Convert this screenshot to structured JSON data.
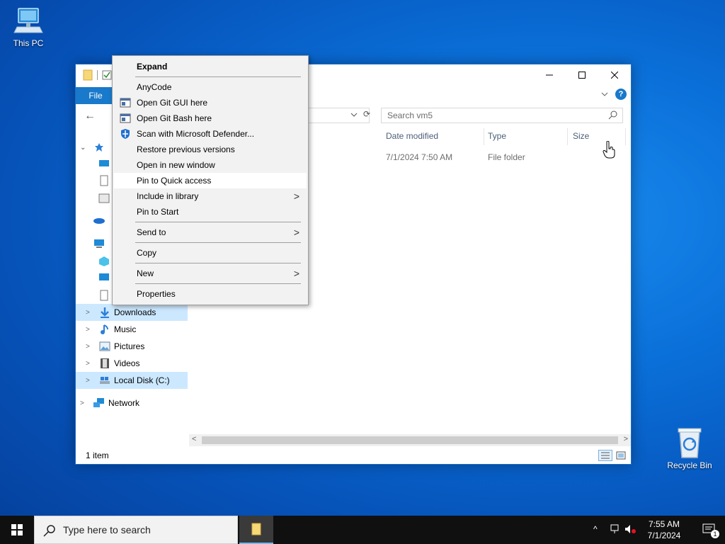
{
  "desktop": {
    "this_pc_label": "This PC",
    "recycle_bin_label": "Recycle Bin"
  },
  "explorer": {
    "ribbon": {
      "file_tab": "File"
    },
    "search_placeholder": "Search vm5",
    "nav_items": [
      {
        "label": "Downloads",
        "selected": true
      },
      {
        "label": "Music"
      },
      {
        "label": "Pictures"
      },
      {
        "label": "Videos"
      },
      {
        "label": "Local Disk (C:)",
        "selected": true
      },
      {
        "label": "Network"
      }
    ],
    "columns": [
      "Date modified",
      "Type",
      "Size"
    ],
    "rows": [
      {
        "date_modified": "7/1/2024 7:50 AM",
        "type": "File folder",
        "size": ""
      }
    ],
    "status": "1 item"
  },
  "context_menu": {
    "expand": "Expand",
    "items": [
      {
        "label": "AnyCode"
      },
      {
        "label": "Open Git GUI here",
        "icon": "git-gui-icon"
      },
      {
        "label": "Open Git Bash here",
        "icon": "git-bash-icon"
      },
      {
        "label": "Scan with Microsoft Defender...",
        "icon": "defender-icon"
      },
      {
        "label": "Restore previous versions"
      },
      {
        "label": "Open in new window"
      },
      {
        "label": "Pin to Quick access",
        "hover": true
      },
      {
        "label": "Include in library",
        "submenu": true
      },
      {
        "label": "Pin to Start"
      },
      {
        "label": "Send to",
        "submenu": true
      },
      {
        "label": "Copy"
      },
      {
        "label": "New",
        "submenu": true
      },
      {
        "label": "Properties"
      }
    ]
  },
  "taskbar": {
    "search_placeholder": "Type here to search",
    "time": "7:55 AM",
    "date": "7/1/2024",
    "notification_count": "1"
  },
  "colors": {
    "accent": "#1979ca",
    "selection": "#cce8ff",
    "taskbar": "#101010"
  }
}
